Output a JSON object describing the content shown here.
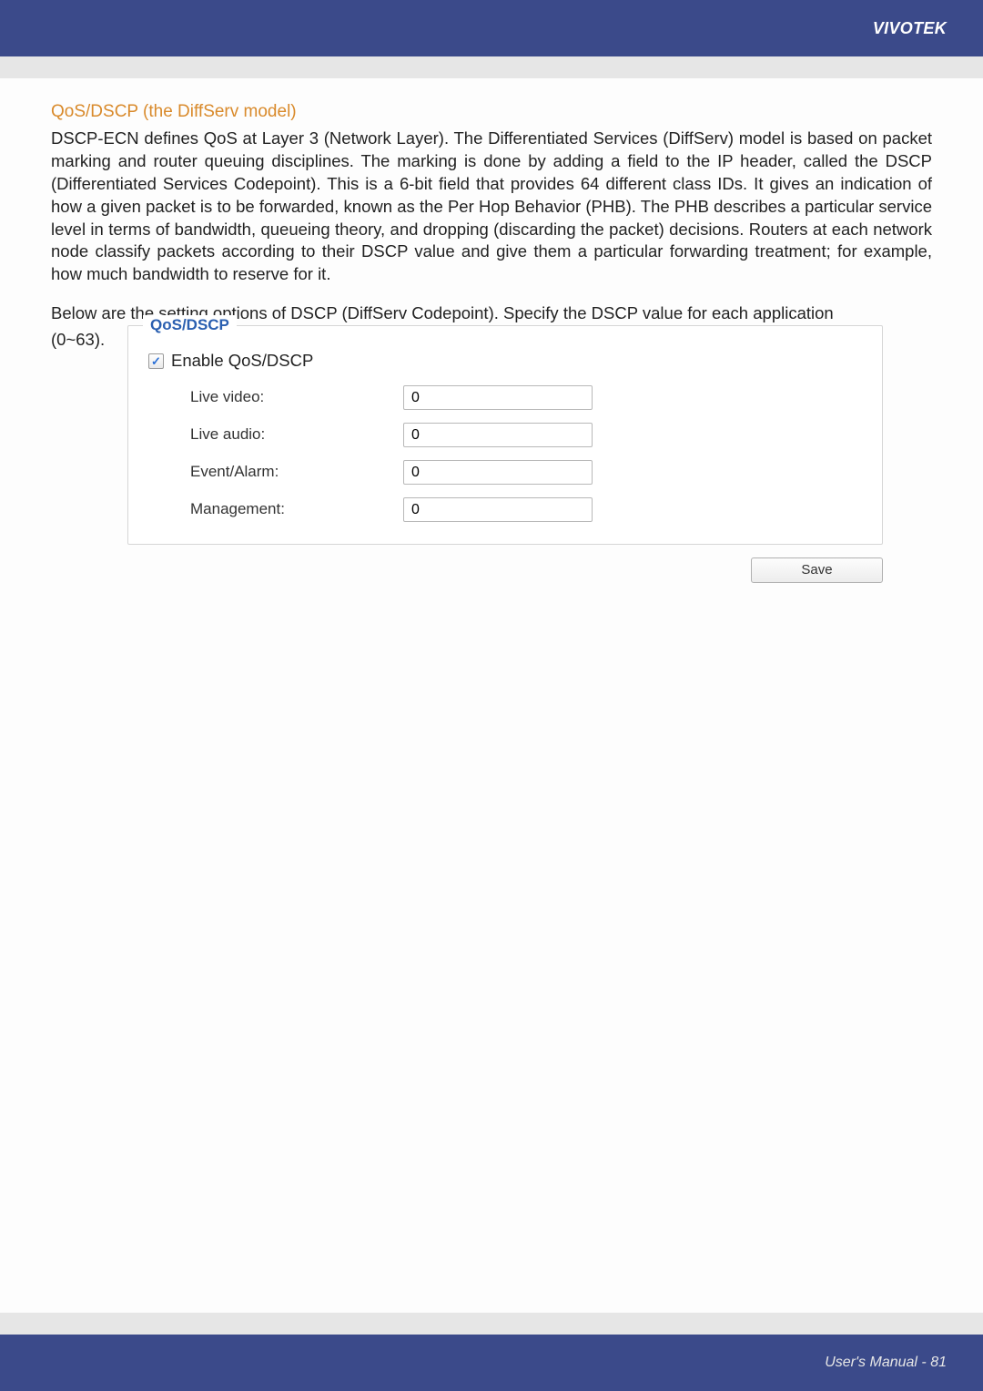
{
  "header": {
    "brand": "VIVOTEK"
  },
  "section": {
    "title": "QoS/DSCP (the DiffServ model)",
    "para1": "DSCP-ECN defines QoS at Layer 3 (Network Layer). The Differentiated Services (DiffServ) model is based on packet marking and router queuing disciplines. The marking is done by adding a field to the IP header, called the DSCP (Differentiated Services Codepoint). This is a 6-bit field that provides 64 different class IDs. It gives an indication of how a given packet is to be forwarded, known as the Per Hop Behavior (PHB). The PHB describes a particular service level in terms of bandwidth, queueing theory, and dropping (discarding the packet) decisions. Routers at each network node classify packets according to their DSCP value and give them a particular forwarding treatment; for example, how much bandwidth to reserve for it.",
    "para2_a": "Below are the setting options of DSCP (DiffServ Codepoint). Specify the DSCP value for each application",
    "para2_b": "(0~63)."
  },
  "panel": {
    "legend": "QoS/DSCP",
    "enable_label": "Enable QoS/DSCP",
    "enable_checked": "✓",
    "rows": {
      "live_video": {
        "label": "Live video:",
        "value": "0"
      },
      "live_audio": {
        "label": "Live audio:",
        "value": "0"
      },
      "event_alarm": {
        "label": "Event/Alarm:",
        "value": "0"
      },
      "management": {
        "label": "Management:",
        "value": "0"
      }
    },
    "save": "Save"
  },
  "footer": {
    "text": "User's Manual - 81"
  }
}
